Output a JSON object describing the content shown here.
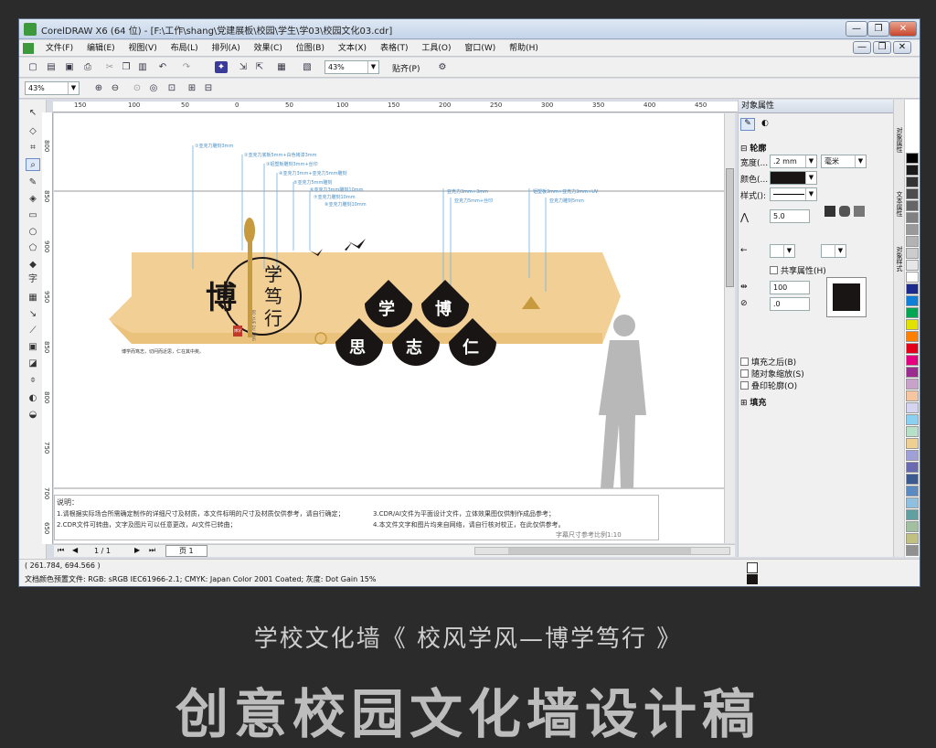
{
  "window": {
    "title": "CorelDRAW X6 (64 位) - [F:\\工作\\shang\\党建展板\\校园\\学生\\学03\\校园文化03.cdr]",
    "controls": [
      "—",
      "❐",
      "✕"
    ],
    "inner_controls": [
      "—",
      "❐",
      "✕"
    ]
  },
  "menu": {
    "items": [
      "文件(F)",
      "编辑(E)",
      "视图(V)",
      "布局(L)",
      "排列(A)",
      "效果(C)",
      "位图(B)",
      "文本(X)",
      "表格(T)",
      "工具(O)",
      "窗口(W)",
      "帮助(H)"
    ]
  },
  "toolbar": {
    "zoom": "43%",
    "snap_label": "贴齐(P)"
  },
  "propbar": {
    "zoom": "43%"
  },
  "ruler": {
    "h_ticks": [
      "150",
      "100",
      "50",
      "0",
      "50",
      "100",
      "150",
      "200",
      "250",
      "300",
      "350",
      "400",
      "450"
    ],
    "v_ticks": [
      "800",
      "850",
      "900",
      "950",
      "850",
      "800",
      "750",
      "700",
      "650"
    ]
  },
  "design": {
    "brand_chars": "博",
    "vertical_title": "学笃行",
    "pinyin": "BO XUE DU XING",
    "seal": "博学",
    "slogan": "博学而笃志，切问而近思，仁在其中矣。",
    "circles": [
      "学",
      "博",
      "思",
      "志",
      "仁"
    ],
    "annotations_left": [
      "①亚克力雕刻3mm",
      "②亚克力底板5mm+白色烤漆3mm",
      "③铝塑板雕刻3mm+丝印",
      "④亚克力3mm+亚克力5mm雕刻",
      "⑤亚克力5mm雕刻",
      "⑥亚克力3mm雕刻10mm",
      "⑦亚克力雕刻10mm",
      "⑧亚克力雕刻10mm"
    ],
    "annotations_right": [
      "亚克力3mm+3mm",
      "亚克力5mm+丝印",
      "铝塑板3mm+亚克力3mm+UV",
      "亚克力雕刻5mm"
    ]
  },
  "notes": {
    "heading": "说明：",
    "left": [
      "1.请根据实际场合所需确定制作的详细尺寸及材质，本文件标明的尺寸及材质仅供参考，请自行确定；",
      "2.CDR文件可转曲，文字及图片可以任意更改，AI文件已转曲；"
    ],
    "right": [
      "3.CDR/AI文件为平面设计文件，立体效果图仅供制作成品参考；",
      "4.本文件文字和图片均来自网络，请自行核对校正，在此仅供参考。"
    ],
    "scale": "字幕尺寸参考比例1:10"
  },
  "pagebar": {
    "page_count": "1 / 1",
    "page_tab": "页 1"
  },
  "status": {
    "coords": "( 261.784, 694.566 )",
    "profile": "文档颜色预置文件: RGB: sRGB IEC61966-2.1; CMYK: Japan Color 2001 Coated; 灰度: Dot Gain 15%"
  },
  "docker": {
    "title": "对象属性",
    "outline_heading": "轮廓",
    "width_label": "宽度(...",
    "width_value": ".2 mm",
    "unit_value": "毫米",
    "color_label": "颜色(...",
    "style_label": "样式():",
    "miter_value": "5.0",
    "shared_attr": "共享属性(H)",
    "stretch_value": "100",
    "angle_value": ".0",
    "fill_behind": "填充之后(B)",
    "scale_with": "随对象缩放(S)",
    "overprint": "叠印轮廓(O)",
    "fill_heading": "填充"
  },
  "side_tabs": [
    "对象属性",
    "文本属性",
    "对象样式"
  ],
  "palette": [
    "#000000",
    "#1a1a1a",
    "#333333",
    "#4d4d4d",
    "#666666",
    "#808080",
    "#999999",
    "#b3b3b3",
    "#cccccc",
    "#e6e6e6",
    "#ffffff",
    "#1b2a8c",
    "#0f7fd8",
    "#00a651",
    "#e2e200",
    "#ff7f00",
    "#e2001a",
    "#e4007f",
    "#9b2d8e",
    "#c8a2c8",
    "#f5c6a0",
    "#d4d4f0",
    "#8ad0f0",
    "#b8e0c8",
    "#f0d090",
    "#a0a0d8",
    "#6a6ab0",
    "#3a5a90",
    "#5a8ac0",
    "#90c0e0",
    "#60a0a0",
    "#a0c0a0",
    "#c0c080",
    "#909090"
  ],
  "colors": {
    "board": "#f2cf95",
    "board_dark": "#e6b96a",
    "accent": "#1a1515",
    "gold": "#c79a3e"
  },
  "banner": {
    "caption": "学校文化墙《 校风学风—博学笃行 》",
    "big": "创意校园文化墙设计稿"
  }
}
